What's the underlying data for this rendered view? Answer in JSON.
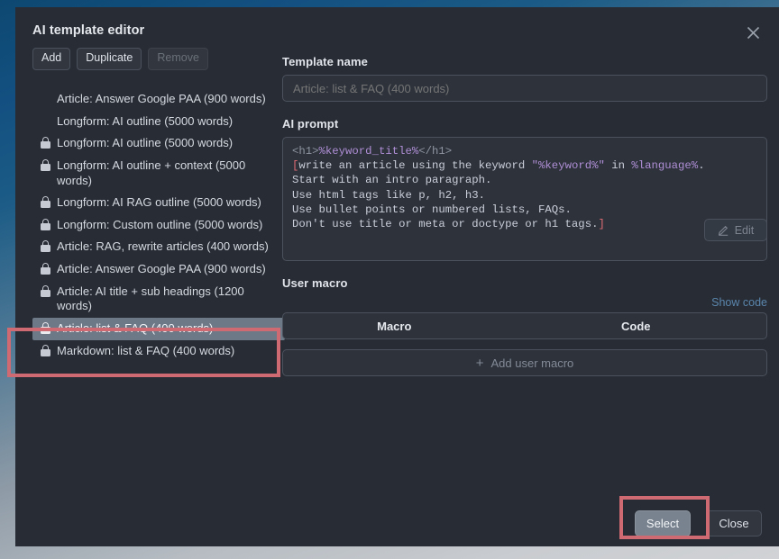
{
  "dialog": {
    "title": "AI template editor",
    "close_icon": "close-icon"
  },
  "toolbar": {
    "add_label": "Add",
    "duplicate_label": "Duplicate",
    "remove_label": "Remove"
  },
  "template_list": {
    "items": [
      {
        "label": "Article: Answer Google PAA (900 words)",
        "locked": false,
        "selected": false
      },
      {
        "label": "Longform: AI outline (5000 words)",
        "locked": false,
        "selected": false
      },
      {
        "label": "Longform: AI outline (5000 words)",
        "locked": true,
        "selected": false
      },
      {
        "label": "Longform: AI outline + context (5000 words)",
        "locked": true,
        "selected": false
      },
      {
        "label": "Longform: AI RAG outline (5000 words)",
        "locked": true,
        "selected": false
      },
      {
        "label": "Longform: Custom outline (5000 words)",
        "locked": true,
        "selected": false
      },
      {
        "label": "Article: RAG, rewrite articles (400 words)",
        "locked": true,
        "selected": false
      },
      {
        "label": "Article: Answer Google PAA (900 words)",
        "locked": true,
        "selected": false
      },
      {
        "label": "Article: AI title + sub headings (1200 words)",
        "locked": true,
        "selected": false
      },
      {
        "label": "Article: list & FAQ (400 words)",
        "locked": true,
        "selected": true
      },
      {
        "label": "Markdown: list & FAQ (400 words)",
        "locked": true,
        "selected": false
      }
    ]
  },
  "template_name": {
    "label": "Template name",
    "value": "",
    "placeholder": "Article: list & FAQ (400 words)"
  },
  "ai_prompt": {
    "label": "AI prompt",
    "lines": [
      "<h1>%keyword_title%</h1>",
      "[write an article using the keyword \"%keyword%\" in %language%.",
      "Start with an intro paragraph.",
      "Use html tags like p, h2, h3.",
      "Use bullet points or numbered lists, FAQs.",
      "Don't use title or meta or doctype or h1 tags.]"
    ]
  },
  "user_macro": {
    "label": "User macro",
    "show_code_label": "Show code",
    "columns": [
      "Macro",
      "Code"
    ],
    "rows": [],
    "add_label": "Add user macro",
    "add_icon": "plus-icon",
    "edit_label": "Edit",
    "edit_icon": "pencil-icon"
  },
  "footer": {
    "select_label": "Select",
    "close_label": "Close"
  },
  "colors": {
    "dialog_bg": "#282c34",
    "selection": "#6e7988",
    "annotation": "#cf6a72",
    "link": "#5a86ad",
    "accent_primary": "#78838f"
  }
}
